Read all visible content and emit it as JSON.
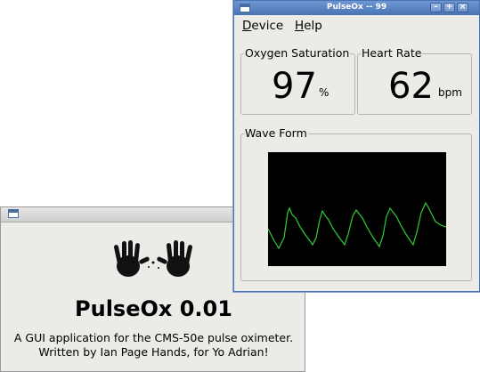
{
  "about": {
    "title": "PulseOx 0.01",
    "line1": "A GUI application for the CMS-50e pulse oximeter.",
    "line2": "Written by Ian Page Hands, for Yo Adrian!",
    "logo_icon": "handprints-icon"
  },
  "main": {
    "window_title": "PulseOx -- 99",
    "menu": {
      "device": "Device",
      "help": "Help"
    },
    "spo2": {
      "label": "Oxygen Saturation",
      "value": "97",
      "unit": "%"
    },
    "heart_rate": {
      "label": "Heart Rate",
      "value": "62",
      "unit": "bpm"
    },
    "waveform": {
      "label": "Wave Form",
      "color": "#2ecc3a",
      "background": "#000000"
    }
  },
  "colors": {
    "titlebar_active": "#4a73b4",
    "window_bg": "#ecebe8"
  }
}
